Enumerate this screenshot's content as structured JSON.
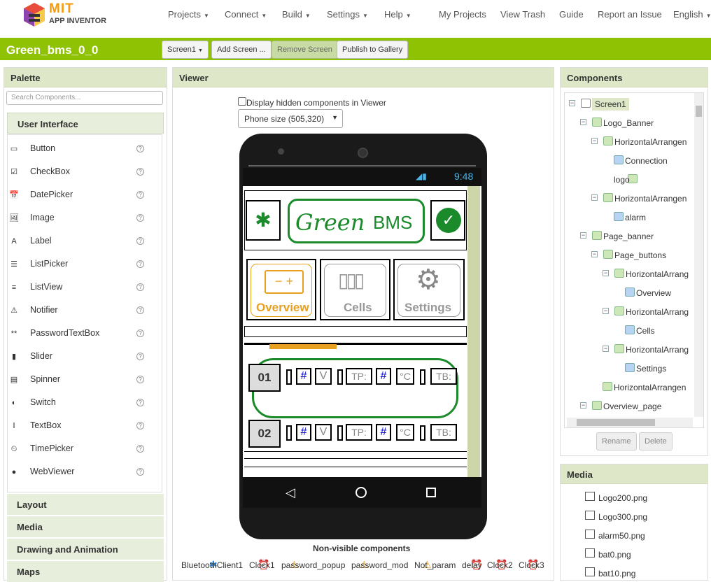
{
  "app": {
    "logo_top": "MIT",
    "logo_bottom": "APP INVENTOR"
  },
  "menu": {
    "projects": "Projects",
    "connect": "Connect",
    "build": "Build",
    "settings": "Settings",
    "help": "Help",
    "my_projects": "My Projects",
    "view_trash": "View Trash",
    "guide": "Guide",
    "report": "Report an Issue",
    "language": "English"
  },
  "project": {
    "name": "Green_bms_0_0",
    "screen_btn": "Screen1",
    "add_screen": "Add Screen ...",
    "remove_screen": "Remove Screen",
    "publish": "Publish to Gallery"
  },
  "palette": {
    "title": "Palette",
    "search_placeholder": "Search Components...",
    "category_open": "User Interface",
    "items": [
      "Button",
      "CheckBox",
      "DatePicker",
      "Image",
      "Label",
      "ListPicker",
      "ListView",
      "Notifier",
      "PasswordTextBox",
      "Slider",
      "Spinner",
      "Switch",
      "TextBox",
      "TimePicker",
      "WebViewer"
    ],
    "categories": [
      "Layout",
      "Media",
      "Drawing and Animation",
      "Maps"
    ]
  },
  "viewer": {
    "title": "Viewer",
    "hidden_label": "Display hidden components in Viewer",
    "phone_size": "Phone size (505,320)",
    "time": "9:48",
    "nonvisible_title": "Non-visible components",
    "app": {
      "brand_green": "Green",
      "brand_bms": "BMS",
      "tab1": "Overview",
      "tab2": "Cells",
      "tab3": "Settings",
      "row1": "01",
      "row2": "02",
      "hash": "#",
      "v": "V",
      "tp": "TP:",
      "c": "°C",
      "tb": "TB:"
    },
    "nonvisible": [
      "BluetoothClient1",
      "Clock1",
      "password_popup",
      "password_mod",
      "Not_param",
      "delay",
      "Clock2",
      "Clock3"
    ]
  },
  "components": {
    "title": "Components",
    "rename": "Rename",
    "delete": "Delete",
    "tree": [
      "Screen1",
      "Logo_Banner",
      "HorizontalArrangen",
      "Connection",
      "logo",
      "HorizontalArrangen",
      "alarm",
      "Page_banner",
      "Page_buttons",
      "HorizontalArrang",
      "Overview",
      "HorizontalArrang",
      "Cells",
      "HorizontalArrang",
      "Settings",
      "HorizontalArrangen",
      "Overview_page"
    ]
  },
  "media": {
    "title": "Media",
    "files": [
      "Logo200.png",
      "Logo300.png",
      "alarm50.png",
      "bat0.png",
      "bat10.png"
    ]
  }
}
